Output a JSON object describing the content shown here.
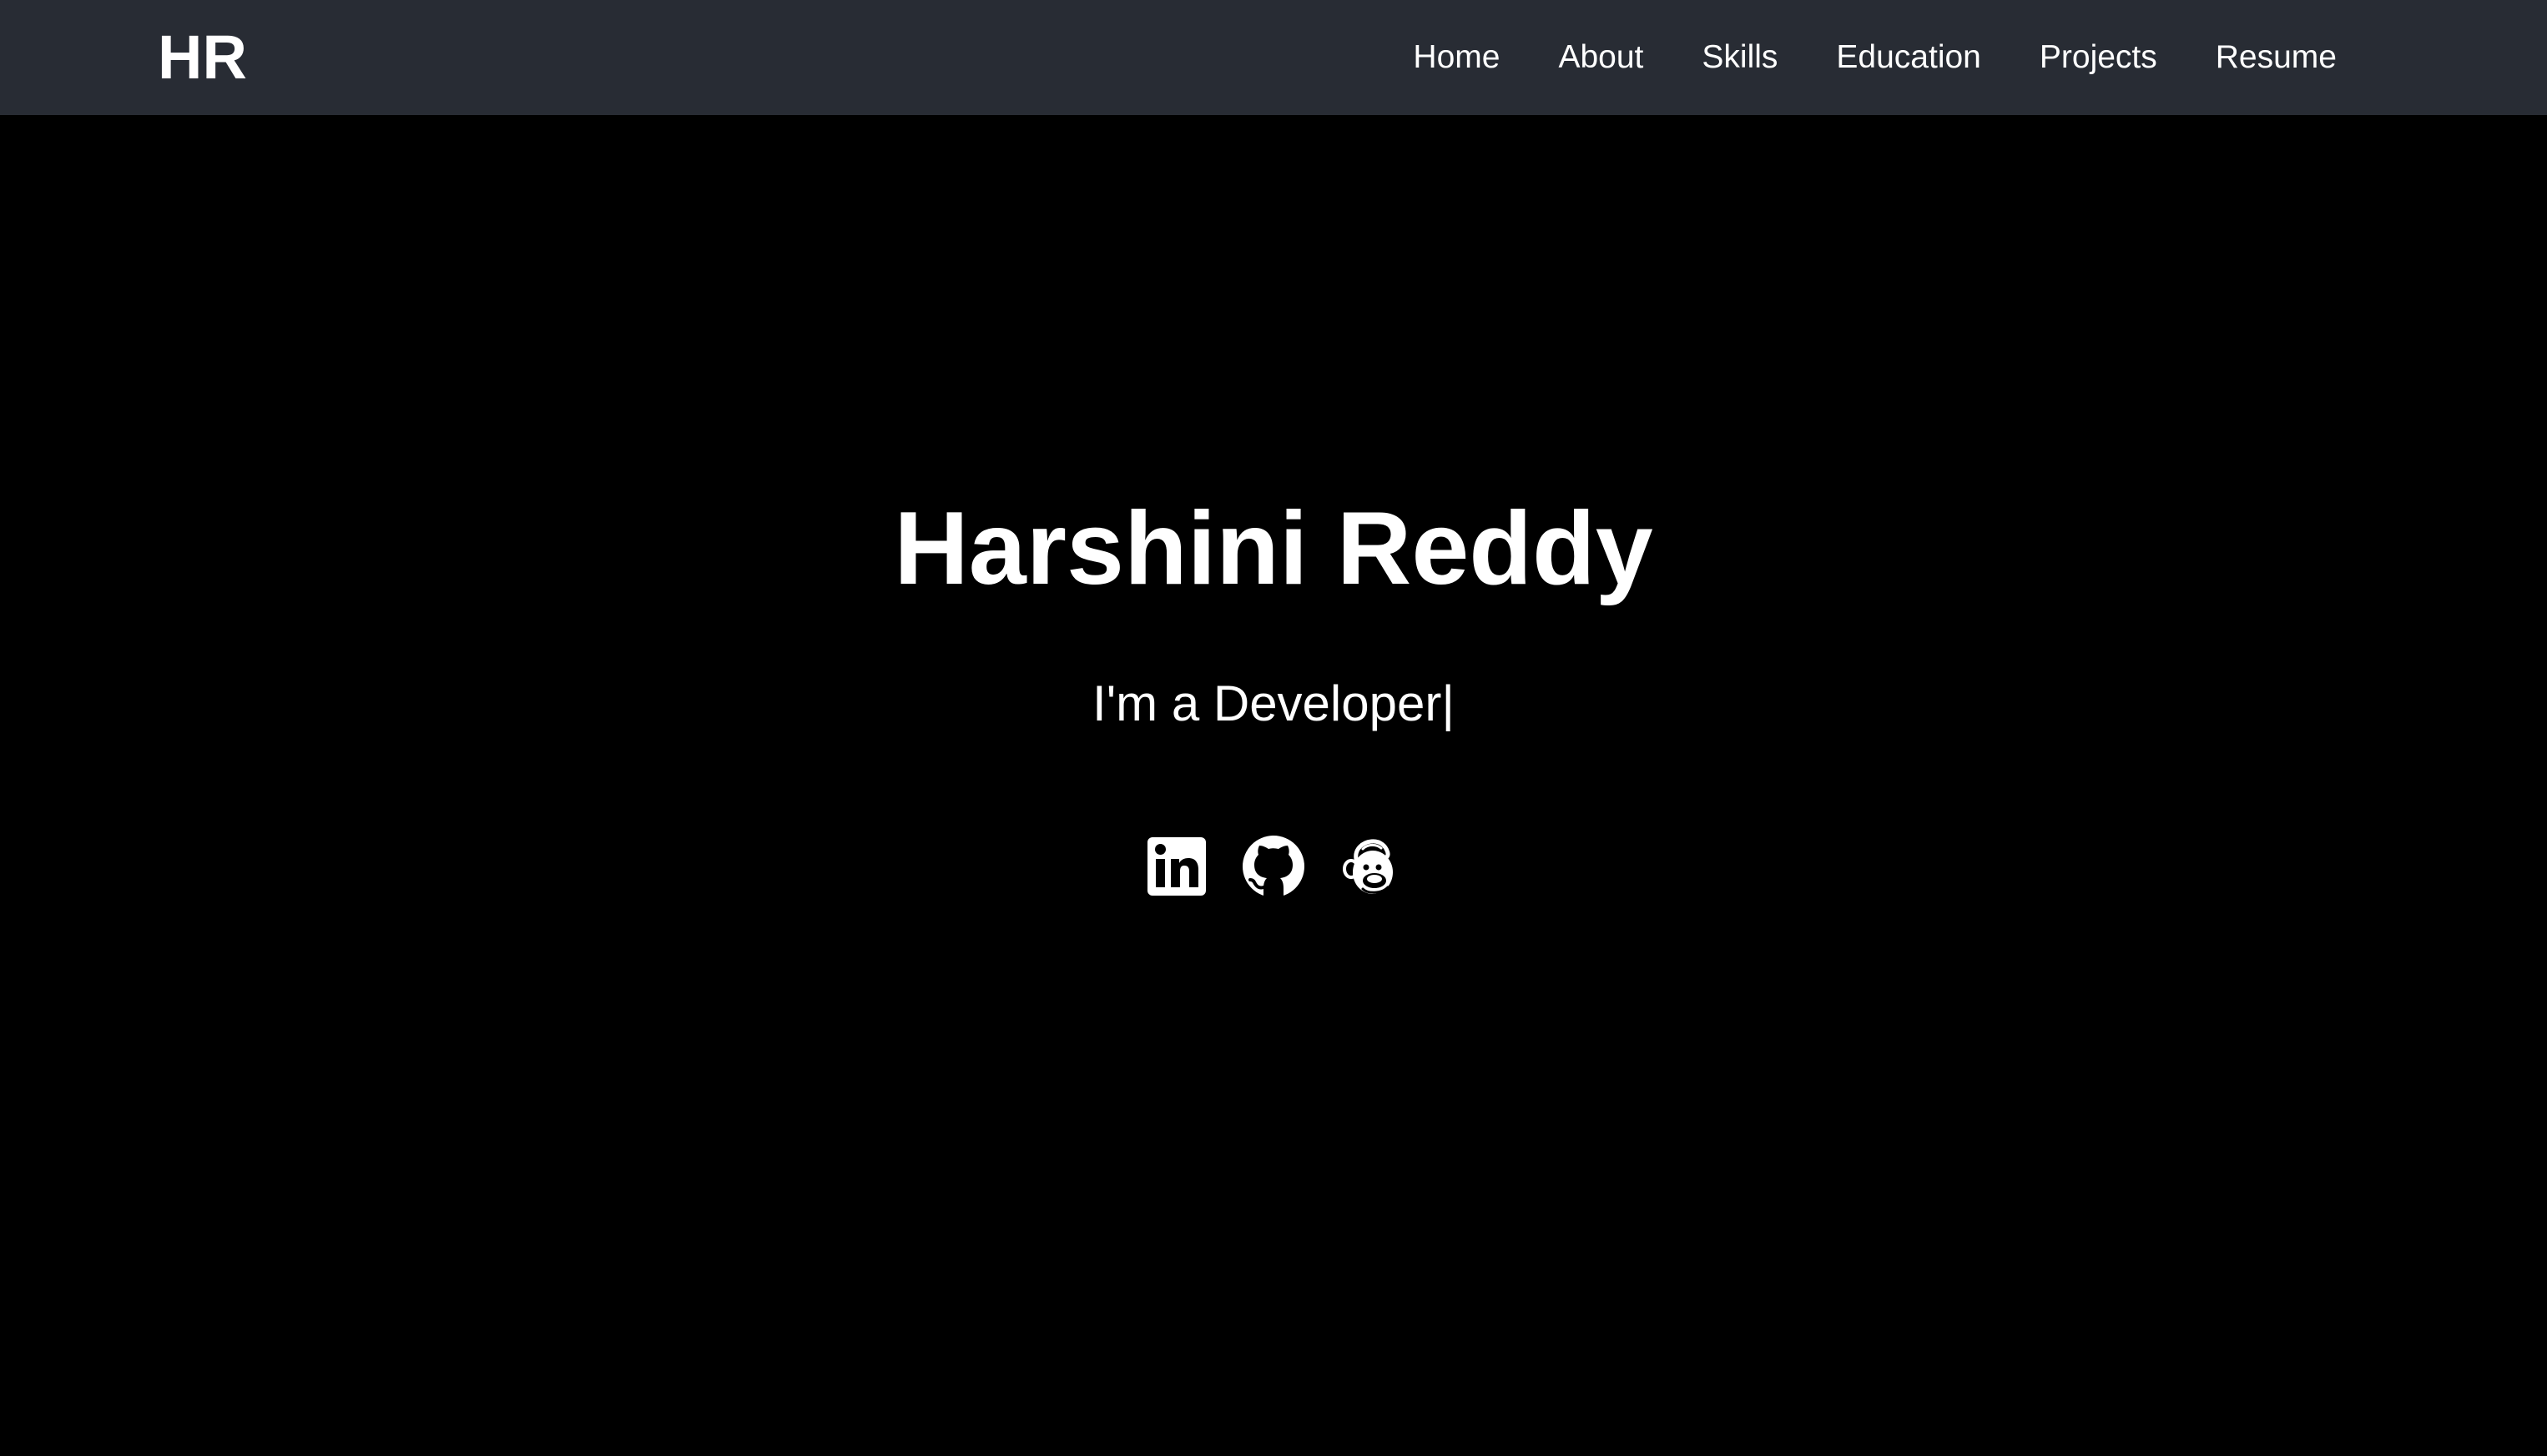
{
  "navbar": {
    "logo": "HR",
    "links": [
      "Home",
      "About",
      "Skills",
      "Education",
      "Projects",
      "Resume"
    ]
  },
  "hero": {
    "name": "Harshini Reddy",
    "tagline": "I'm a Developer|"
  },
  "socials": [
    {
      "icon": "linkedin-icon"
    },
    {
      "icon": "github-icon"
    },
    {
      "icon": "mailchimp-icon"
    }
  ],
  "colors": {
    "navbar_bg": "#282c34",
    "page_bg": "#000000",
    "text": "#ffffff"
  }
}
